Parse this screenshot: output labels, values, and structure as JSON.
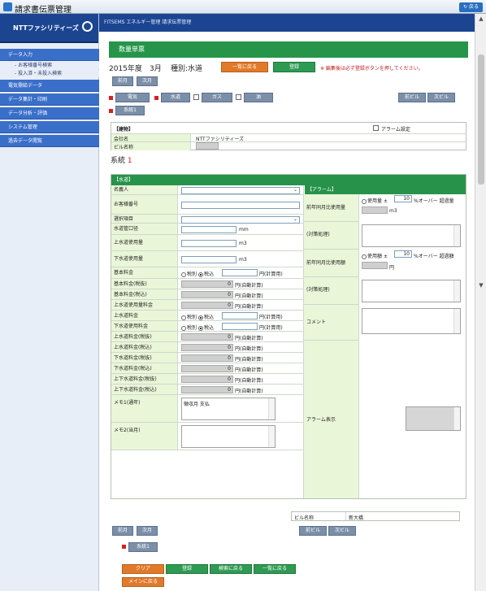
{
  "app": {
    "title": "請求書伝票管理",
    "back_label": "戻る",
    "logo": "NTTファシリティーズ"
  },
  "breadcrumb": "FITSEMS エネルギー管理 請求伝票管理",
  "sidebar": {
    "items": [
      {
        "label": "データ入力"
      },
      {
        "label": "電気需給データ"
      },
      {
        "label": "データ集計・印刷"
      },
      {
        "label": "データ分析・評価"
      },
      {
        "label": "システム管理"
      },
      {
        "label": "過去データ閲覧"
      }
    ],
    "sub_items": [
      {
        "label": "お客様番号検索"
      },
      {
        "label": "投入済・未投入検索"
      }
    ]
  },
  "section_title": "数量単票",
  "period": {
    "year": "2015年度",
    "month": "3月",
    "kind": "種別:水道"
  },
  "buttons": {
    "back_to_list": "一覧に戻る",
    "register": "登録",
    "prev_month": "前月",
    "next_month": "次月",
    "electric": "電気",
    "water": "水道",
    "gas": "ガス",
    "oil": "油",
    "prev_bldg": "前ビル",
    "next_bldg": "次ビル",
    "system1": "系統1",
    "clear": "クリア",
    "back_to_search": "検索に戻る",
    "back_to_menu": "メインに戻る"
  },
  "notice": "※ 編集後は必ず登録ボタンを押してください。",
  "building": {
    "header": "【建物】",
    "alarm_label": "アラーム設定",
    "company_label": "会社名",
    "company_value": "NTTファシリティーズ",
    "building_label": "ビル名称",
    "system_label": "系統",
    "system_no": "1"
  },
  "water": {
    "header": "【水道】",
    "alarm_header": "【アラーム】",
    "left_rows": [
      {
        "label": "名義人"
      },
      {
        "label": "お客様番号"
      },
      {
        "label": "選択項目"
      },
      {
        "label": "水道管口径",
        "unit": "mm"
      },
      {
        "label": "上水道使用量",
        "unit": "m3"
      },
      {
        "label": "下水道使用量",
        "unit": "m3"
      },
      {
        "label": "基本料金"
      },
      {
        "label": "基本料金(税抜)",
        "value": "0",
        "note": "円(自動計算)"
      },
      {
        "label": "基本料金(税込)",
        "value": "0",
        "note": "円(自動計算)"
      },
      {
        "label": "上水道使用量料金",
        "value": "0",
        "note": "円(自動計算)"
      },
      {
        "label": "上水道料金"
      },
      {
        "label": "下水道使用料金"
      },
      {
        "label": "上水道料金(税抜)",
        "value": "0",
        "note": "円(自動計算)"
      },
      {
        "label": "上水道料金(税込)",
        "value": "0",
        "note": "円(自動計算)"
      },
      {
        "label": "下水道料金(税抜)",
        "value": "0",
        "note": "円(自動計算)"
      },
      {
        "label": "下水道料金(税込)",
        "value": "0",
        "note": "円(自動計算)"
      },
      {
        "label": "上下水道料金(税抜)",
        "value": "0",
        "note": "円(自動計算)"
      },
      {
        "label": "上下水道料金(税込)",
        "value": "0",
        "note": "円(自動計算)"
      },
      {
        "label": "メモ1(通年)",
        "value": "徴収月 支払"
      },
      {
        "label": "メモ2(当月)"
      }
    ],
    "tax_excl": "税別",
    "tax_incl": "税込",
    "tax_note": "円(計算用)",
    "right": {
      "prev_year_usage_label": "前年同月比使用量",
      "prev_year_usage_prefix": "使用量 ±",
      "prev_year_usage_value": "10",
      "prev_year_usage_suffix": "%オーバー 超過量",
      "prev_year_usage_unit": "m3",
      "reason1_label": "(対策処理)",
      "prev_year_amount_label": "前年同月比使用額",
      "prev_year_amount_prefix": "使用額 ±",
      "prev_year_amount_value": "10",
      "prev_year_amount_suffix": "%オーバー 超過額",
      "prev_year_amount_unit": "円",
      "reason2_label": "(対策処理)",
      "comment_label": "コメント",
      "alarm_display_label": "アラーム表示"
    }
  },
  "footer": {
    "building_label": "ビル名称",
    "building_value": "新大橋"
  },
  "colors": {
    "nav": "#1c4591",
    "section": "#26954a",
    "label_bg": "#eaf6d8",
    "accent": "#e07a2a"
  }
}
